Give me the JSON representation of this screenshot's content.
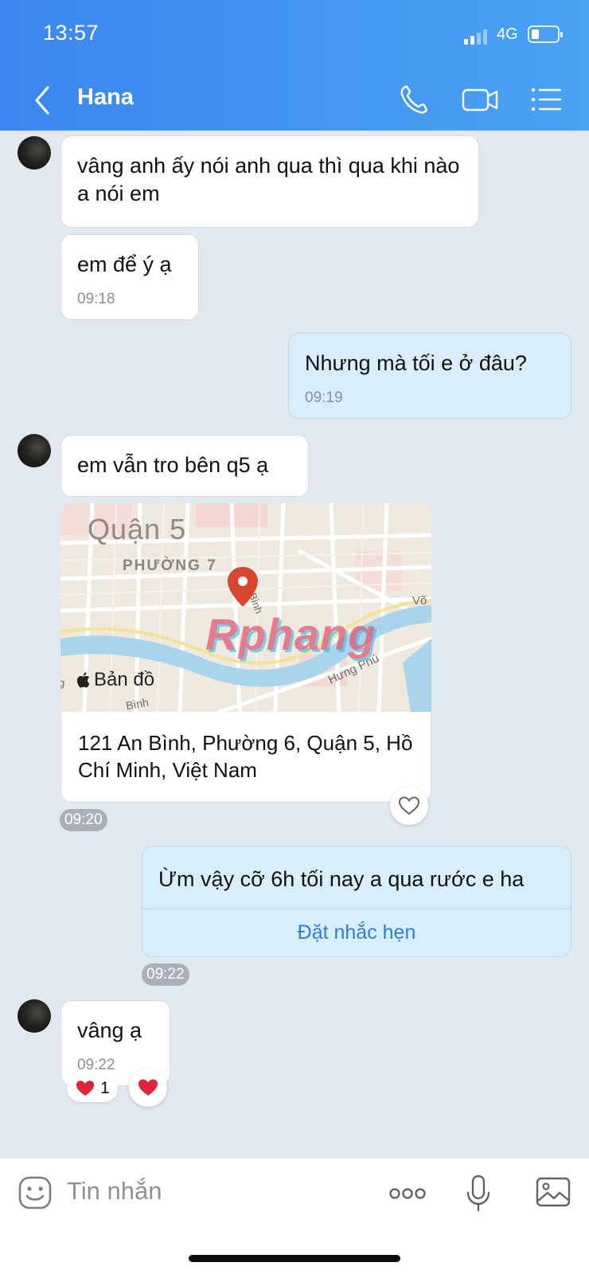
{
  "status": {
    "time": "13:57",
    "network": "4G"
  },
  "header": {
    "title": "Hana"
  },
  "messages": {
    "m1_text": "vâng anh ấy nói anh qua thì qua khi nào a nói em",
    "m2_text": "em để ý ạ",
    "m2_time": "09:18",
    "m3_text": "Nhưng mà tối e ở đâu?",
    "m3_time": "09:19",
    "m4_text": "em vẫn tro bên q5 ạ",
    "map": {
      "district": "Quận 5",
      "ward": "PHƯỜNG 7",
      "street_vo": "Võ",
      "street_hung_phu": "Hưng Phú",
      "street_binh_a": "Bình",
      "street_binh_b": "Bình",
      "street_g": "g",
      "maps_label": "Bản đồ",
      "watermark": "Rphang",
      "address": "121 An Bình, Phường 6, Quận 5, Hồ Chí Minh, Việt Nam",
      "time": "09:20"
    },
    "m6_text": "Ừm vậy cỡ 6h tối nay a qua rước e ha",
    "m6_reminder": "Đặt nhắc hẹn",
    "m6_time": "09:22",
    "m7_text": "vâng ạ",
    "m7_time": "09:22",
    "reaction_count": "1"
  },
  "composer": {
    "placeholder": "Tin nhắn"
  },
  "colors": {
    "header_start": "#3b86f0",
    "header_end": "#4aa2f2",
    "my_bubble": "#d8eefc",
    "link": "#2f7ce6",
    "pin": "#d9442e"
  }
}
